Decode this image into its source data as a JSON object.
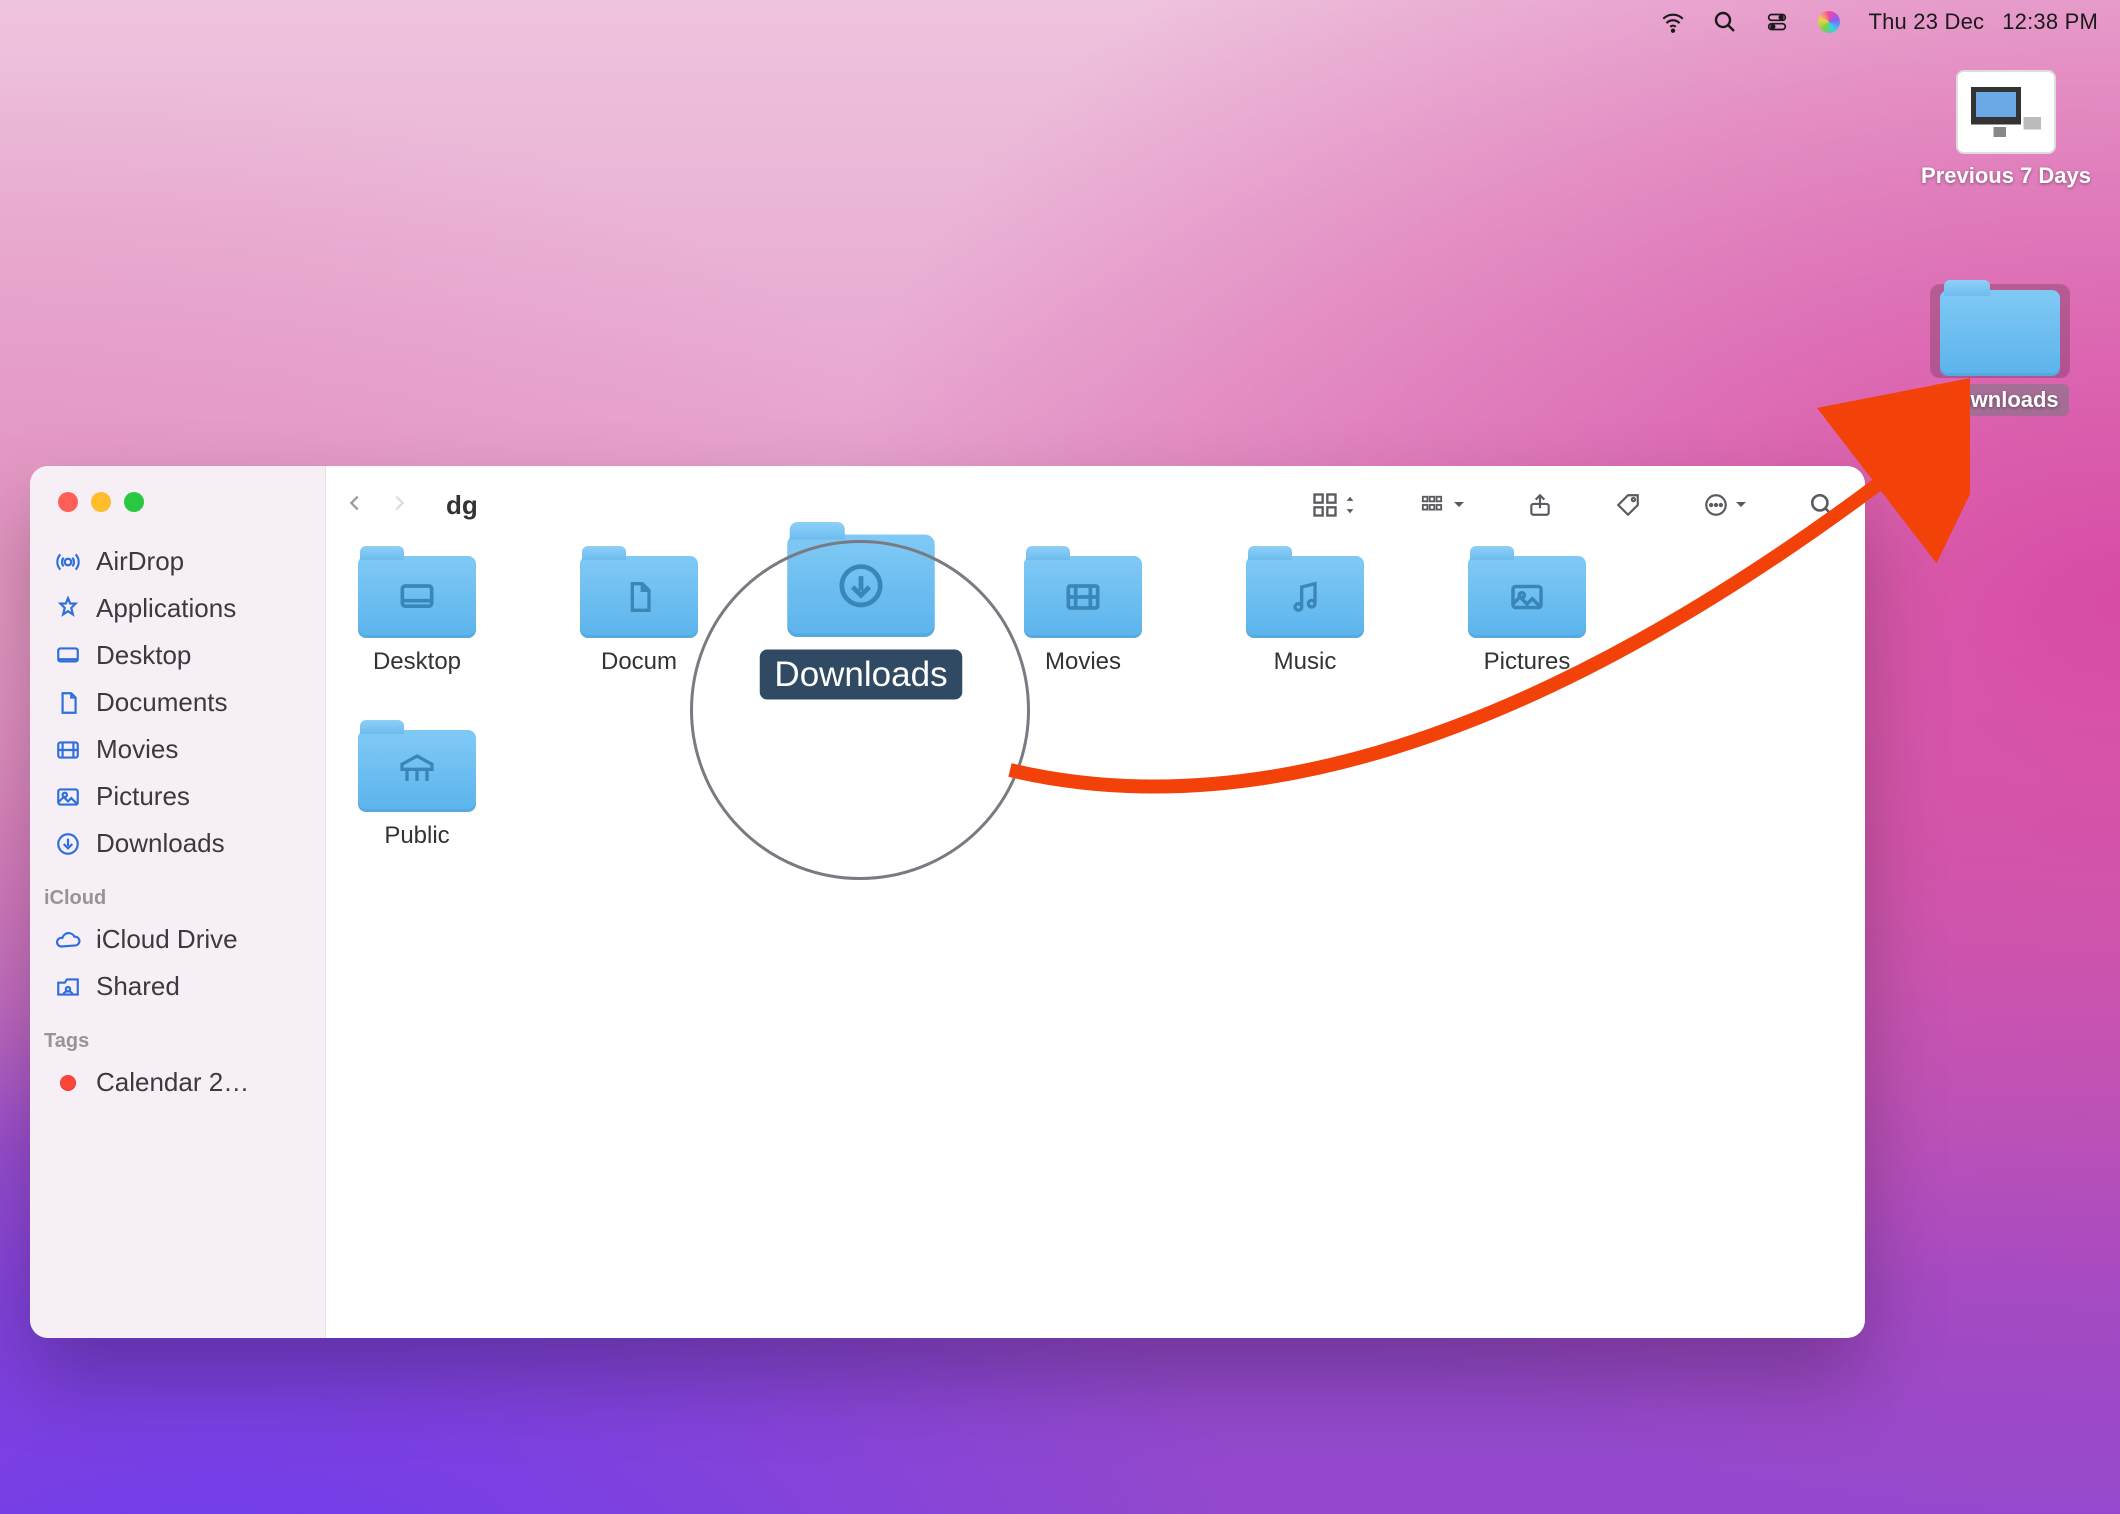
{
  "menubar": {
    "date": "Thu 23 Dec",
    "time": "12:38 PM"
  },
  "desktop": {
    "items": [
      {
        "label": "Previous 7 Days"
      },
      {
        "label": "Downloads"
      }
    ]
  },
  "finder": {
    "title": "dg",
    "sidebar": {
      "favorites": [
        {
          "label": "AirDrop",
          "icon": "airdrop"
        },
        {
          "label": "Applications",
          "icon": "applications"
        },
        {
          "label": "Desktop",
          "icon": "desktop"
        },
        {
          "label": "Documents",
          "icon": "documents"
        },
        {
          "label": "Movies",
          "icon": "movies"
        },
        {
          "label": "Pictures",
          "icon": "pictures"
        },
        {
          "label": "Downloads",
          "icon": "downloads"
        }
      ],
      "icloud_header": "iCloud",
      "icloud": [
        {
          "label": "iCloud Drive",
          "icon": "cloud"
        },
        {
          "label": "Shared",
          "icon": "shared"
        }
      ],
      "tags_header": "Tags",
      "tags": [
        {
          "label": "Calendar 2…",
          "color": "#fe453a"
        }
      ]
    },
    "folders": [
      {
        "name": "Desktop",
        "glyph": "desktop"
      },
      {
        "name": "Docum",
        "glyph": "document"
      },
      {
        "name": "Downloads",
        "glyph": "download",
        "selected": true
      },
      {
        "name": "Movies",
        "glyph": "movie"
      },
      {
        "name": "Music",
        "glyph": "music"
      },
      {
        "name": "Pictures",
        "glyph": "picture"
      },
      {
        "name": "Public",
        "glyph": "public"
      }
    ]
  }
}
